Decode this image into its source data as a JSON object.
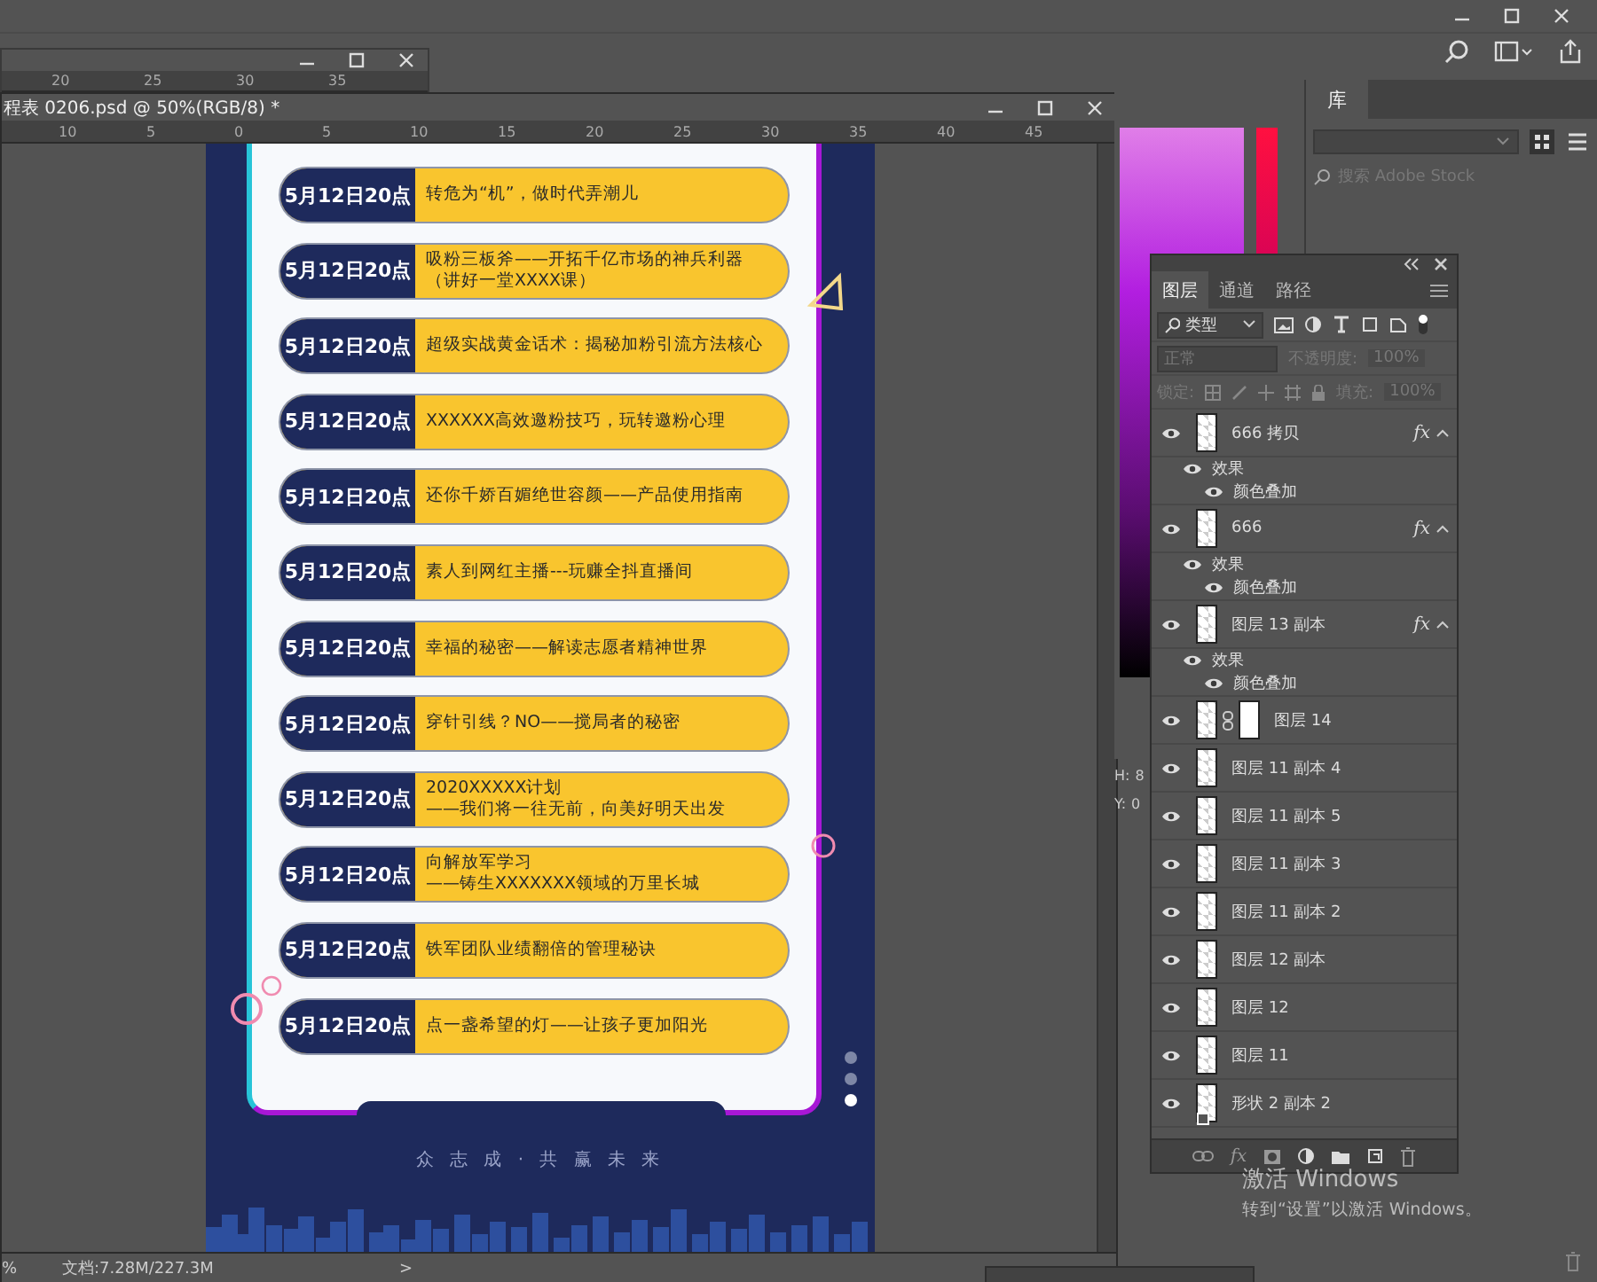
{
  "back_window": {
    "ruler": [
      "20",
      "25",
      "30",
      "35"
    ]
  },
  "document": {
    "title": "程表 0206.psd @ 50%(RGB/8) *",
    "ruler": [
      "10",
      "5",
      "0",
      "5",
      "10",
      "15",
      "20",
      "25",
      "30",
      "35",
      "40",
      "45"
    ],
    "zoom": "%",
    "status": "文档:7.28M/227.3M",
    "status_arrow": ">"
  },
  "design": {
    "sessions": [
      {
        "time": "5月12日20点",
        "title": [
          "转危为“机”，做时代弄潮儿"
        ]
      },
      {
        "time": "5月12日20点",
        "title": [
          "吸粉三板斧——开拓千亿市场的神兵利器",
          "（讲好一堂XXXX课）"
        ]
      },
      {
        "time": "5月12日20点",
        "title": [
          "超级实战黄金话术：揭秘加粉引流方法核心"
        ]
      },
      {
        "time": "5月12日20点",
        "title": [
          "XXXXXX高效邀粉技巧，玩转邀粉心理"
        ]
      },
      {
        "time": "5月12日20点",
        "title": [
          "还你千娇百媚绝世容颜——产品使用指南"
        ]
      },
      {
        "time": "5月12日20点",
        "title": [
          "素人到网红主播---玩赚全抖直播间"
        ]
      },
      {
        "time": "5月12日20点",
        "title": [
          "幸福的秘密——解读志愿者精神世界"
        ]
      },
      {
        "time": "5月12日20点",
        "title": [
          "穿针引线？NO——搅局者的秘密"
        ]
      },
      {
        "time": "5月12日20点",
        "title": [
          "2020XXXXX计划",
          "——我们将一往无前，向美好明天出发"
        ]
      },
      {
        "time": "5月12日20点",
        "title": [
          "向解放军学习",
          "——铸生XXXXXXX领域的万里长城"
        ]
      },
      {
        "time": "5月12日20点",
        "title": [
          "铁军团队业绩翻倍的管理秘诀"
        ]
      },
      {
        "time": "5月12日20点",
        "title": [
          "点一盏希望的灯——让孩子更加阳光"
        ]
      }
    ],
    "pager": [
      {
        "selected": false
      },
      {
        "selected": false
      },
      {
        "selected": true
      }
    ],
    "slogan": "众 志 成 · 共 赢 未 来"
  },
  "info": [
    {
      "label": "H:",
      "value": "8"
    },
    {
      "label": "Y:",
      "value": "0"
    }
  ],
  "library": {
    "tab": "库",
    "placeholder": "搜索 Adobe Stock"
  },
  "layers_panel": {
    "tabs": [
      {
        "label": "图层",
        "selected": true
      },
      {
        "label": "通道",
        "selected": false
      },
      {
        "label": "路径",
        "selected": false
      }
    ],
    "footer_fx": "fx",
    "filter": "类型",
    "blend": "正常",
    "opacity_label": "不透明度:",
    "opacity": "100%",
    "lock_label": "锁定:",
    "fill_label": "填充:",
    "fill": "100%",
    "layers": [
      {
        "name": "666 拷贝",
        "kind": "pixel",
        "visible": true,
        "mask": false,
        "fx": "fx",
        "effects": [
          {
            "label": "效果",
            "visible": true,
            "children": [
              {
                "label": "颜色叠加",
                "visible": true
              }
            ]
          }
        ]
      },
      {
        "name": "666",
        "kind": "pixel",
        "visible": true,
        "mask": false,
        "fx": "fx",
        "effects": [
          {
            "label": "效果",
            "visible": true,
            "children": [
              {
                "label": "颜色叠加",
                "visible": true
              }
            ]
          }
        ]
      },
      {
        "name": "图层 13 副本",
        "kind": "pixel",
        "visible": true,
        "mask": false,
        "fx": "fx",
        "effects": [
          {
            "label": "效果",
            "visible": true,
            "children": [
              {
                "label": "颜色叠加",
                "visible": true
              }
            ]
          }
        ]
      },
      {
        "name": "图层 14",
        "kind": "pixel",
        "visible": true,
        "mask": true
      },
      {
        "name": "图层 11 副本 4",
        "kind": "pixel",
        "visible": true,
        "mask": false
      },
      {
        "name": "图层 11 副本 5",
        "kind": "pixel",
        "visible": true,
        "mask": false
      },
      {
        "name": "图层 11 副本 3",
        "kind": "pixel",
        "visible": true,
        "mask": false
      },
      {
        "name": "图层 11 副本 2",
        "kind": "pixel",
        "visible": true,
        "mask": false
      },
      {
        "name": "图层 12 副本",
        "kind": "pixel",
        "visible": true,
        "mask": false
      },
      {
        "name": "图层 12",
        "kind": "pixel",
        "visible": true,
        "mask": false
      },
      {
        "name": "图层 11",
        "kind": "pixel",
        "visible": true,
        "mask": false
      },
      {
        "name": "形状 2 副本 2",
        "kind": "shape",
        "visible": true,
        "mask": false
      }
    ]
  },
  "windows_notice": {
    "title": "激活 Windows",
    "text": "转到“设置”以激活 Windows。"
  }
}
